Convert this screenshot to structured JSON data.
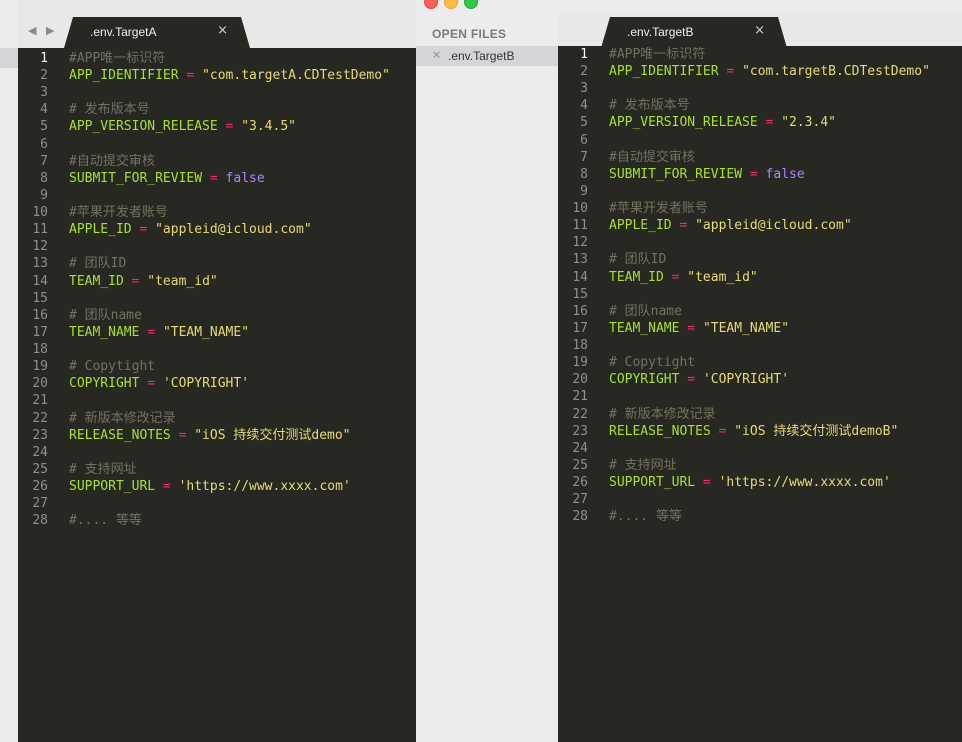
{
  "left_window": {
    "nav_arrows": "◀ ▶",
    "tab": {
      "label": ".env.TargetA",
      "close": "×"
    },
    "lines": [
      {
        "n": "1",
        "tokens": [
          {
            "t": "comment",
            "v": "#APP唯一标识符"
          }
        ]
      },
      {
        "n": "2",
        "tokens": [
          {
            "t": "key",
            "v": "APP_IDENTIFIER"
          },
          {
            "t": "plain",
            "v": " "
          },
          {
            "t": "op",
            "v": "="
          },
          {
            "t": "plain",
            "v": " "
          },
          {
            "t": "str",
            "v": "\"com.targetA.CDTestDemo\""
          }
        ]
      },
      {
        "n": "3",
        "tokens": []
      },
      {
        "n": "4",
        "tokens": [
          {
            "t": "comment",
            "v": "# 发布版本号"
          }
        ]
      },
      {
        "n": "5",
        "tokens": [
          {
            "t": "key",
            "v": "APP_VERSION_RELEASE"
          },
          {
            "t": "plain",
            "v": " "
          },
          {
            "t": "op",
            "v": "="
          },
          {
            "t": "plain",
            "v": " "
          },
          {
            "t": "str",
            "v": "\"3.4.5\""
          }
        ]
      },
      {
        "n": "6",
        "tokens": []
      },
      {
        "n": "7",
        "tokens": [
          {
            "t": "comment",
            "v": "#自动提交审核"
          }
        ]
      },
      {
        "n": "8",
        "tokens": [
          {
            "t": "key",
            "v": "SUBMIT_FOR_REVIEW"
          },
          {
            "t": "plain",
            "v": " "
          },
          {
            "t": "op",
            "v": "="
          },
          {
            "t": "plain",
            "v": " "
          },
          {
            "t": "bool",
            "v": "false"
          }
        ]
      },
      {
        "n": "9",
        "tokens": []
      },
      {
        "n": "10",
        "tokens": [
          {
            "t": "comment",
            "v": "#苹果开发者账号"
          }
        ]
      },
      {
        "n": "11",
        "tokens": [
          {
            "t": "key",
            "v": "APPLE_ID"
          },
          {
            "t": "plain",
            "v": " "
          },
          {
            "t": "op",
            "v": "="
          },
          {
            "t": "plain",
            "v": " "
          },
          {
            "t": "str",
            "v": "\"appleid@icloud.com\""
          }
        ]
      },
      {
        "n": "12",
        "tokens": []
      },
      {
        "n": "13",
        "tokens": [
          {
            "t": "comment",
            "v": "# 团队ID"
          }
        ]
      },
      {
        "n": "14",
        "tokens": [
          {
            "t": "key",
            "v": "TEAM_ID"
          },
          {
            "t": "plain",
            "v": " "
          },
          {
            "t": "op",
            "v": "="
          },
          {
            "t": "plain",
            "v": " "
          },
          {
            "t": "str",
            "v": "\"team_id\""
          }
        ]
      },
      {
        "n": "15",
        "tokens": []
      },
      {
        "n": "16",
        "tokens": [
          {
            "t": "comment",
            "v": "# 团队name"
          }
        ]
      },
      {
        "n": "17",
        "tokens": [
          {
            "t": "key",
            "v": "TEAM_NAME"
          },
          {
            "t": "plain",
            "v": " "
          },
          {
            "t": "op",
            "v": "="
          },
          {
            "t": "plain",
            "v": " "
          },
          {
            "t": "str",
            "v": "\"TEAM_NAME\""
          }
        ]
      },
      {
        "n": "18",
        "tokens": []
      },
      {
        "n": "19",
        "tokens": [
          {
            "t": "comment",
            "v": "# Copytight"
          }
        ]
      },
      {
        "n": "20",
        "tokens": [
          {
            "t": "key",
            "v": "COPYRIGHT"
          },
          {
            "t": "plain",
            "v": " "
          },
          {
            "t": "op",
            "v": "="
          },
          {
            "t": "plain",
            "v": " "
          },
          {
            "t": "str",
            "v": "'COPYRIGHT'"
          }
        ]
      },
      {
        "n": "21",
        "tokens": []
      },
      {
        "n": "22",
        "tokens": [
          {
            "t": "comment",
            "v": "# 新版本修改记录"
          }
        ]
      },
      {
        "n": "23",
        "tokens": [
          {
            "t": "key",
            "v": "RELEASE_NOTES"
          },
          {
            "t": "plain",
            "v": " "
          },
          {
            "t": "op",
            "v": "="
          },
          {
            "t": "plain",
            "v": " "
          },
          {
            "t": "str",
            "v": "\"iOS 持续交付测试demo\""
          }
        ]
      },
      {
        "n": "24",
        "tokens": []
      },
      {
        "n": "25",
        "tokens": [
          {
            "t": "comment",
            "v": "# 支持网址"
          }
        ]
      },
      {
        "n": "26",
        "tokens": [
          {
            "t": "key",
            "v": "SUPPORT_URL"
          },
          {
            "t": "plain",
            "v": " "
          },
          {
            "t": "op",
            "v": "="
          },
          {
            "t": "plain",
            "v": " "
          },
          {
            "t": "str",
            "v": "'https://www.xxxx.com'"
          }
        ]
      },
      {
        "n": "27",
        "tokens": []
      },
      {
        "n": "28",
        "tokens": [
          {
            "t": "comment",
            "v": "#.... 等等"
          }
        ]
      }
    ]
  },
  "right_window": {
    "sidebar": {
      "title": "OPEN FILES",
      "files": [
        {
          "name": ".env.TargetB",
          "close": "×"
        }
      ]
    },
    "tab": {
      "label": ".env.TargetB",
      "close": "×"
    },
    "lines": [
      {
        "n": "1",
        "tokens": [
          {
            "t": "comment",
            "v": "#APP唯一标识符"
          }
        ]
      },
      {
        "n": "2",
        "tokens": [
          {
            "t": "key",
            "v": "APP_IDENTIFIER"
          },
          {
            "t": "plain",
            "v": " "
          },
          {
            "t": "op",
            "v": "="
          },
          {
            "t": "plain",
            "v": " "
          },
          {
            "t": "str",
            "v": "\"com.targetB.CDTestDemo\""
          }
        ]
      },
      {
        "n": "3",
        "tokens": []
      },
      {
        "n": "4",
        "tokens": [
          {
            "t": "comment",
            "v": "# 发布版本号"
          }
        ]
      },
      {
        "n": "5",
        "tokens": [
          {
            "t": "key",
            "v": "APP_VERSION_RELEASE"
          },
          {
            "t": "plain",
            "v": " "
          },
          {
            "t": "op",
            "v": "="
          },
          {
            "t": "plain",
            "v": " "
          },
          {
            "t": "str",
            "v": "\"2.3.4\""
          }
        ]
      },
      {
        "n": "6",
        "tokens": []
      },
      {
        "n": "7",
        "tokens": [
          {
            "t": "comment",
            "v": "#自动提交审核"
          }
        ]
      },
      {
        "n": "8",
        "tokens": [
          {
            "t": "key",
            "v": "SUBMIT_FOR_REVIEW"
          },
          {
            "t": "plain",
            "v": " "
          },
          {
            "t": "op",
            "v": "="
          },
          {
            "t": "plain",
            "v": " "
          },
          {
            "t": "bool",
            "v": "false"
          }
        ]
      },
      {
        "n": "9",
        "tokens": []
      },
      {
        "n": "10",
        "tokens": [
          {
            "t": "comment",
            "v": "#苹果开发者账号"
          }
        ]
      },
      {
        "n": "11",
        "tokens": [
          {
            "t": "key",
            "v": "APPLE_ID"
          },
          {
            "t": "plain",
            "v": " "
          },
          {
            "t": "op",
            "v": "="
          },
          {
            "t": "plain",
            "v": " "
          },
          {
            "t": "str",
            "v": "\"appleid@icloud.com\""
          }
        ]
      },
      {
        "n": "12",
        "tokens": []
      },
      {
        "n": "13",
        "tokens": [
          {
            "t": "comment",
            "v": "# 团队ID"
          }
        ]
      },
      {
        "n": "14",
        "tokens": [
          {
            "t": "key",
            "v": "TEAM_ID"
          },
          {
            "t": "plain",
            "v": " "
          },
          {
            "t": "op",
            "v": "="
          },
          {
            "t": "plain",
            "v": " "
          },
          {
            "t": "str",
            "v": "\"team_id\""
          }
        ]
      },
      {
        "n": "15",
        "tokens": []
      },
      {
        "n": "16",
        "tokens": [
          {
            "t": "comment",
            "v": "# 团队name"
          }
        ]
      },
      {
        "n": "17",
        "tokens": [
          {
            "t": "key",
            "v": "TEAM_NAME"
          },
          {
            "t": "plain",
            "v": " "
          },
          {
            "t": "op",
            "v": "="
          },
          {
            "t": "plain",
            "v": " "
          },
          {
            "t": "str",
            "v": "\"TEAM_NAME\""
          }
        ]
      },
      {
        "n": "18",
        "tokens": []
      },
      {
        "n": "19",
        "tokens": [
          {
            "t": "comment",
            "v": "# Copytight"
          }
        ]
      },
      {
        "n": "20",
        "tokens": [
          {
            "t": "key",
            "v": "COPYRIGHT"
          },
          {
            "t": "plain",
            "v": " "
          },
          {
            "t": "op",
            "v": "="
          },
          {
            "t": "plain",
            "v": " "
          },
          {
            "t": "str",
            "v": "'COPYRIGHT'"
          }
        ]
      },
      {
        "n": "21",
        "tokens": []
      },
      {
        "n": "22",
        "tokens": [
          {
            "t": "comment",
            "v": "# 新版本修改记录"
          }
        ]
      },
      {
        "n": "23",
        "tokens": [
          {
            "t": "key",
            "v": "RELEASE_NOTES"
          },
          {
            "t": "plain",
            "v": " "
          },
          {
            "t": "op",
            "v": "="
          },
          {
            "t": "plain",
            "v": " "
          },
          {
            "t": "str",
            "v": "\"iOS 持续交付测试demoB\""
          }
        ]
      },
      {
        "n": "24",
        "tokens": []
      },
      {
        "n": "25",
        "tokens": [
          {
            "t": "comment",
            "v": "# 支持网址"
          }
        ]
      },
      {
        "n": "26",
        "tokens": [
          {
            "t": "key",
            "v": "SUPPORT_URL"
          },
          {
            "t": "plain",
            "v": " "
          },
          {
            "t": "op",
            "v": "="
          },
          {
            "t": "plain",
            "v": " "
          },
          {
            "t": "str",
            "v": "'https://www.xxxx.com'"
          }
        ]
      },
      {
        "n": "27",
        "tokens": []
      },
      {
        "n": "28",
        "tokens": [
          {
            "t": "comment",
            "v": "#.... 等等"
          }
        ]
      }
    ]
  },
  "colors": {
    "editor_bg": "#272822",
    "comment": "#75715e",
    "key": "#a6e22e",
    "operator": "#f92672",
    "string": "#e6db74",
    "boolean": "#ae81ff",
    "gutter": "#8f908a"
  }
}
